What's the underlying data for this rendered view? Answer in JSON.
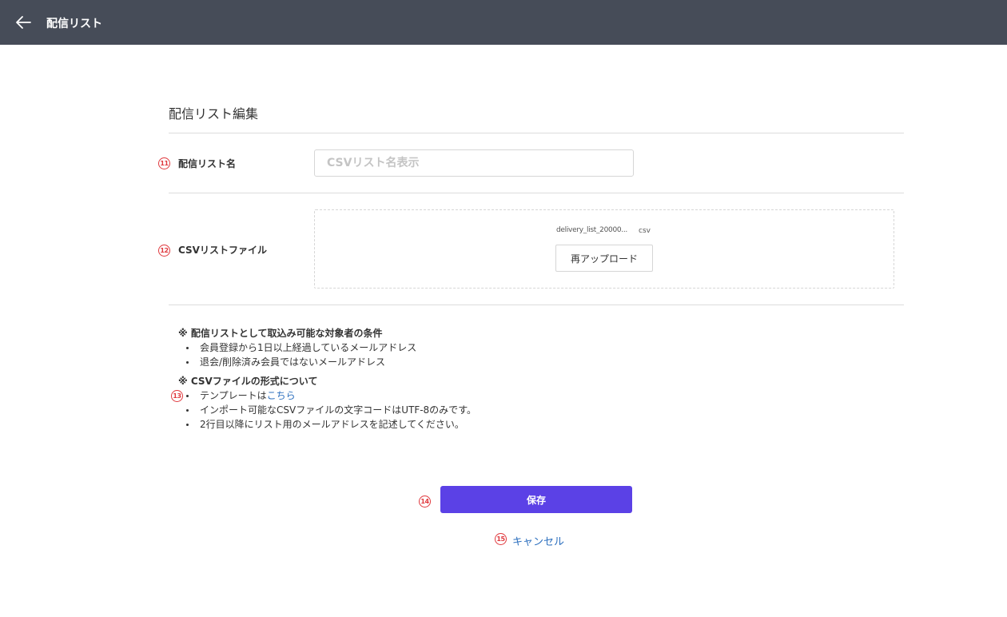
{
  "header": {
    "back_icon": "arrow-left-icon",
    "title": "配信リスト"
  },
  "form": {
    "section_title": "配信リスト編集",
    "list_name": {
      "marker": "11",
      "label": "配信リスト名",
      "placeholder": "CSVリスト名表示",
      "value": ""
    },
    "csv_file": {
      "marker": "12",
      "label": "CSVリストファイル",
      "file_name": "delivery_list_20000...",
      "file_ext": "csv",
      "reupload_label": "再アップロード"
    }
  },
  "notes": {
    "marker": "13",
    "condition_heading": "※ 配信リストとして取込み可能な対象者の条件",
    "condition_items": [
      "会員登録から1日以上経過しているメールアドレス",
      "退会/削除済み会員ではないメールアドレス"
    ],
    "format_heading": "※ CSVファイルの形式について",
    "template_prefix": "テンプレートは",
    "template_link": "こちら",
    "format_items": [
      "インポート可能なCSVファイルの文字コードはUTF-8のみです。",
      "2行目以降にリスト用のメールアドレスを記述してください。"
    ]
  },
  "actions": {
    "save_marker": "14",
    "save_label": "保存",
    "cancel_marker": "15",
    "cancel_label": "キャンセル"
  },
  "colors": {
    "header_bg": "#464c58",
    "primary": "#5b41e6",
    "link": "#2c6fbe",
    "marker": "#e0393e"
  }
}
